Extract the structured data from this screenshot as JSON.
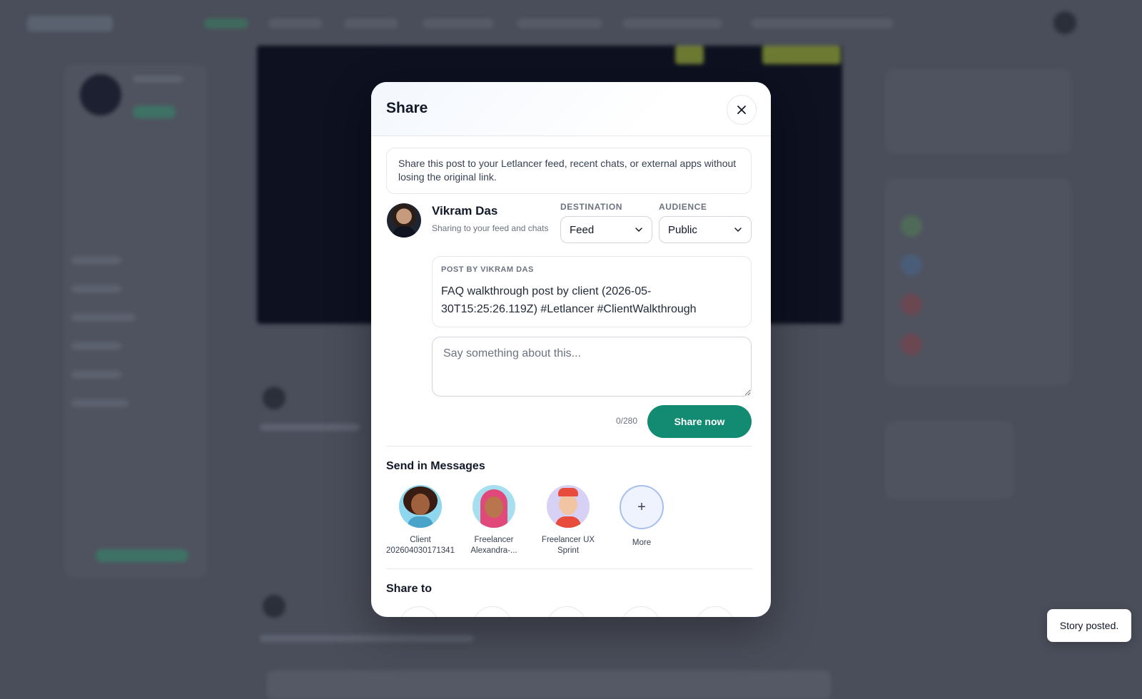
{
  "modal": {
    "title": "Share",
    "info_text": "Share this post to your Letlancer feed, recent chats, or external apps without losing the original link.",
    "user": {
      "name": "Vikram Das",
      "subtitle": "Sharing to your feed and chats"
    },
    "destination": {
      "label": "DESTINATION",
      "value": "Feed"
    },
    "audience": {
      "label": "AUDIENCE",
      "value": "Public"
    },
    "post": {
      "label": "POST BY VIKRAM DAS",
      "text": "FAQ walkthrough post by client (2026-05-30T15:25:26.119Z) #Letlancer #ClientWalkthrough"
    },
    "comment": {
      "placeholder": "Say something about this...",
      "value": ""
    },
    "counter": "0/280",
    "share_button": "Share now",
    "messages": {
      "title": "Send in Messages",
      "contacts": [
        {
          "name": "Client 202604030171341"
        },
        {
          "name": "Freelancer Alexandra-..."
        },
        {
          "name": "Freelancer UX Sprint"
        }
      ],
      "more_label": "More",
      "more_icon": "+"
    },
    "share_to": {
      "title": "Share to"
    }
  },
  "toast": {
    "text": "Story posted."
  },
  "colors": {
    "accent": "#138a72",
    "overlay": "#4a4e5a",
    "more_border": "#a7bff0"
  },
  "icons": {
    "close": "close-icon",
    "chevron": "chevron-down-icon",
    "plus": "plus-icon"
  }
}
